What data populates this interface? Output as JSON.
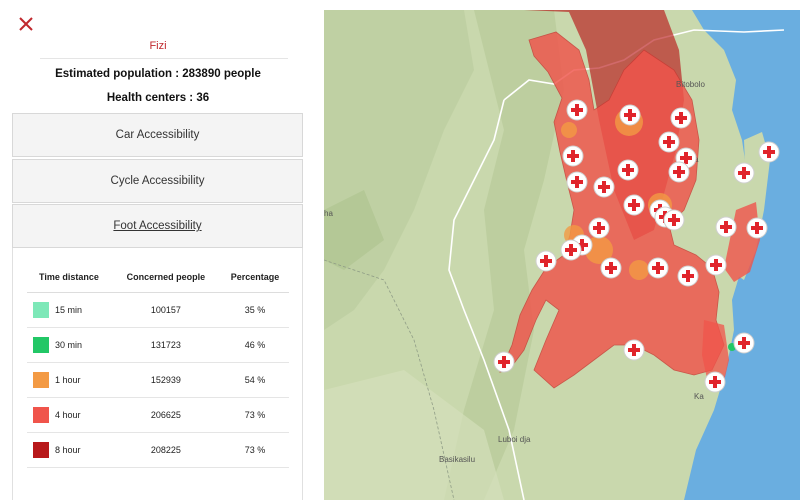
{
  "panel": {
    "region_name": "Fizi",
    "population_label": "Estimated population : 283890 people",
    "health_centers_label": "Health centers : 36",
    "accordions": {
      "car": "Car Accessibility",
      "cycle": "Cycle Accessibility",
      "foot": "Foot Accessibility"
    },
    "table": {
      "headers": [
        "Time distance",
        "Concerned people",
        "Percentage"
      ],
      "rows": [
        {
          "time": "15 min",
          "people": "100157",
          "percent": "35 %",
          "color": "#7de8b8"
        },
        {
          "time": "30 min",
          "people": "131723",
          "percent": "46 %",
          "color": "#22c766"
        },
        {
          "time": "1 hour",
          "people": "152939",
          "percent": "54 %",
          "color": "#f39a44"
        },
        {
          "time": "4 hour",
          "people": "206625",
          "percent": "73 %",
          "color": "#f0544b"
        },
        {
          "time": "8 hour",
          "people": "208225",
          "percent": "73 %",
          "color": "#b8181a"
        }
      ]
    }
  },
  "map": {
    "place_labels": [
      "Bitobolo",
      "Luboi dja",
      "Basikasilu",
      "Ka",
      "a",
      "ha"
    ],
    "colors": {
      "lake": "#6aaee0",
      "land": "#c9d8ad",
      "land_dark": "#b5c99a",
      "isochrone": "#f0544b",
      "isochrone_dark": "#b8181a",
      "isochrone_orange": "#f39a44",
      "marker_cross": "#e0242b"
    }
  }
}
